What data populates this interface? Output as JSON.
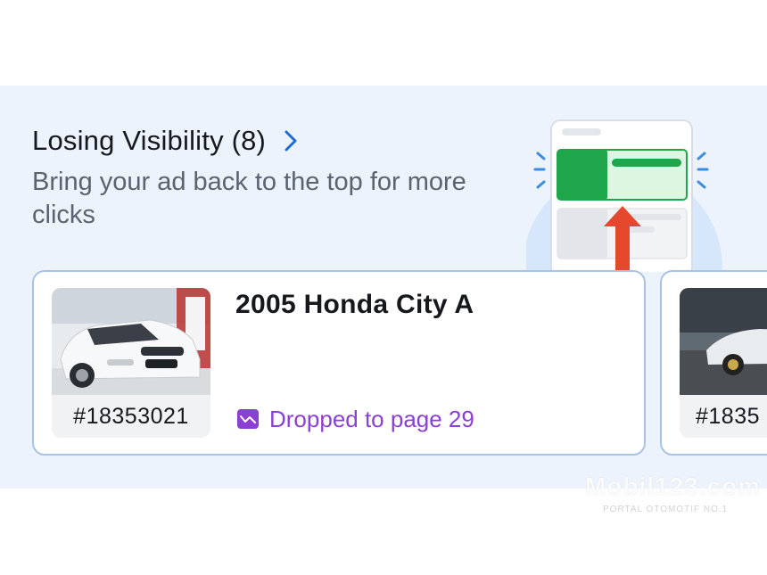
{
  "section": {
    "title": "Losing Visibility (8)",
    "subtitle": "Bring your ad back to the top for more clicks"
  },
  "cards": [
    {
      "title": "2005 Honda City A",
      "ad_id": "#18353021",
      "status": "Dropped to page 29"
    },
    {
      "ad_id": "#1835"
    }
  ],
  "watermark": {
    "brand": "Mobil123.com",
    "tagline": "PORTAL OTOMOTIF NO.1"
  },
  "colors": {
    "panel_bg": "#edf3fc",
    "card_border": "#a9c2e4",
    "status_purple": "#8b3fd3",
    "chevron_blue": "#1f6bd6",
    "illu_green": "#1fa64a",
    "illu_arrow_red": "#e5482c"
  },
  "icons": {
    "title_chevron": "chevron-right-icon",
    "status": "trend-down-icon"
  }
}
